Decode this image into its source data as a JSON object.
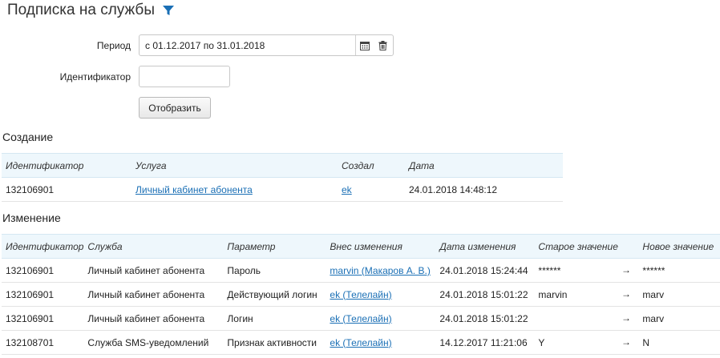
{
  "header": {
    "title": "Подписка на службы",
    "filter_icon": "filter-icon",
    "accent": "#1a6fb5"
  },
  "form": {
    "period_label": "Период",
    "period_value": "с 01.12.2017 по 31.01.2018",
    "identifier_label": "Идентификатор",
    "identifier_value": "",
    "show_button": "Отобразить"
  },
  "creation": {
    "title": "Создание",
    "columns": [
      "Идентификатор",
      "Услуга",
      "Создал",
      "Дата"
    ],
    "rows": [
      {
        "id": "132106901",
        "service": "Личный кабинет абонента",
        "creator": "ek",
        "date": "24.01.2018 14:48:12"
      }
    ]
  },
  "changes": {
    "title": "Изменение",
    "columns": [
      "Идентификатор",
      "Служба",
      "Параметр",
      "Внес изменения",
      "Дата изменения",
      "Старое значение",
      "Новое значение"
    ],
    "arrow": "→",
    "rows": [
      {
        "id": "132106901",
        "service": "Личный кабинет абонента",
        "param": "Пароль",
        "author": "marvin (Макаров А. В.)",
        "date": "24.01.2018 15:24:44",
        "old": "******",
        "new": "******"
      },
      {
        "id": "132106901",
        "service": "Личный кабинет абонента",
        "param": "Действующий логин",
        "author": "ek (Телелайн)",
        "date": "24.01.2018 15:01:22",
        "old": "marvin",
        "new": "marv"
      },
      {
        "id": "132106901",
        "service": "Личный кабинет абонента",
        "param": "Логин",
        "author": "ek (Телелайн)",
        "date": "24.01.2018 15:01:22",
        "old": "",
        "new": "marv"
      },
      {
        "id": "132108701",
        "service": "Служба SMS-уведомлений",
        "param": "Признак активности",
        "author": "ek (Телелайн)",
        "date": "14.12.2017 11:21:06",
        "old": "Y",
        "new": "N"
      }
    ]
  }
}
